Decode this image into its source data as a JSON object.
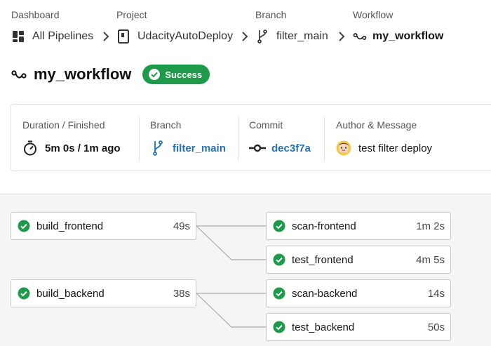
{
  "breadcrumb": {
    "dashboard": {
      "caption": "Dashboard",
      "value": "All Pipelines"
    },
    "project": {
      "caption": "Project",
      "value": "UdacityAutoDeploy"
    },
    "branch": {
      "caption": "Branch",
      "value": "filter_main"
    },
    "workflow": {
      "caption": "Workflow",
      "value": "my_workflow"
    }
  },
  "header": {
    "title": "my_workflow",
    "status": "Success"
  },
  "info": {
    "duration": {
      "caption": "Duration / Finished",
      "value": "5m 0s / 1m ago"
    },
    "branch": {
      "caption": "Branch",
      "value": "filter_main"
    },
    "commit": {
      "caption": "Commit",
      "value": "dec3f7a"
    },
    "author": {
      "caption": "Author & Message",
      "value": "test filter deploy"
    }
  },
  "jobs": [
    {
      "name": "build_frontend",
      "duration": "49s",
      "status": "success"
    },
    {
      "name": "build_backend",
      "duration": "38s",
      "status": "success"
    },
    {
      "name": "scan-frontend",
      "duration": "1m 2s",
      "status": "success"
    },
    {
      "name": "test_frontend",
      "duration": "4m 5s",
      "status": "success"
    },
    {
      "name": "scan-backend",
      "duration": "14s",
      "status": "success"
    },
    {
      "name": "test_backend",
      "duration": "50s",
      "status": "success"
    }
  ],
  "colors": {
    "success": "#1d9a4a",
    "link": "#2272b8",
    "canvas": "#f5f5f5"
  },
  "icons": {
    "dashboard": "dashboard-grid-icon",
    "project": "project-book-icon",
    "branch": "git-branch-icon",
    "workflow": "workflow-icon",
    "duration": "timer-icon",
    "commit": "git-commit-icon",
    "author": "avatar",
    "status": "check-circle-icon"
  }
}
